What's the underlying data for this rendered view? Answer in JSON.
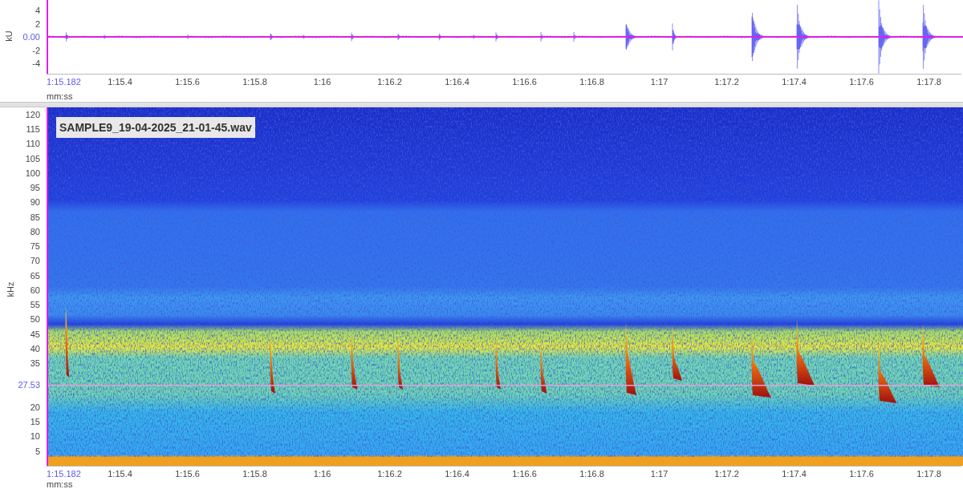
{
  "waveform_panel": {
    "y_axis_label": "kU",
    "y_ticks": [
      {
        "label": "4",
        "highlighted": false
      },
      {
        "label": "2",
        "highlighted": false
      },
      {
        "label": "0.00",
        "highlighted": true
      },
      {
        "label": "-2",
        "highlighted": false
      },
      {
        "label": "-4",
        "highlighted": false
      }
    ],
    "time_axis": {
      "ticks": [
        {
          "label": "1:15.182",
          "highlighted": true
        },
        {
          "label": "1:15.4",
          "highlighted": false
        },
        {
          "label": "1:15.6",
          "highlighted": false
        },
        {
          "label": "1:15.8",
          "highlighted": false
        },
        {
          "label": "1:16",
          "highlighted": false
        },
        {
          "label": "1:16.2",
          "highlighted": false
        },
        {
          "label": "1:16.4",
          "highlighted": false
        },
        {
          "label": "1:16.6",
          "highlighted": false
        },
        {
          "label": "1:16.8",
          "highlighted": false
        },
        {
          "label": "1:17",
          "highlighted": false
        },
        {
          "label": "1:17.2",
          "highlighted": false
        },
        {
          "label": "1:17.4",
          "highlighted": false
        },
        {
          "label": "1:17.6",
          "highlighted": false
        },
        {
          "label": "1:17.8",
          "highlighted": false
        }
      ],
      "unit": "mm:ss"
    }
  },
  "spectrogram_panel": {
    "file_label": "SAMPLE9_19-04-2025_21-01-45.wav",
    "y_axis_label": "kHz",
    "y_ticks": [
      {
        "label": "120",
        "highlighted": false
      },
      {
        "label": "115",
        "highlighted": false
      },
      {
        "label": "110",
        "highlighted": false
      },
      {
        "label": "105",
        "highlighted": false
      },
      {
        "label": "100",
        "highlighted": false
      },
      {
        "label": "95",
        "highlighted": false
      },
      {
        "label": "90",
        "highlighted": false
      },
      {
        "label": "85",
        "highlighted": false
      },
      {
        "label": "80",
        "highlighted": false
      },
      {
        "label": "75",
        "highlighted": false
      },
      {
        "label": "70",
        "highlighted": false
      },
      {
        "label": "65",
        "highlighted": false
      },
      {
        "label": "60",
        "highlighted": false
      },
      {
        "label": "55",
        "highlighted": false
      },
      {
        "label": "50",
        "highlighted": false
      },
      {
        "label": "45",
        "highlighted": false
      },
      {
        "label": "40",
        "highlighted": false
      },
      {
        "label": "35",
        "highlighted": false
      },
      {
        "label": "27.53",
        "highlighted": true
      },
      {
        "label": "20",
        "highlighted": false
      },
      {
        "label": "15",
        "highlighted": false
      },
      {
        "label": "10",
        "highlighted": false
      },
      {
        "label": "5",
        "highlighted": false
      }
    ],
    "time_axis": {
      "ticks": [
        {
          "label": "1:15.182",
          "highlighted": true
        },
        {
          "label": "1:15.4",
          "highlighted": false
        },
        {
          "label": "1:15.6",
          "highlighted": false
        },
        {
          "label": "1:15.8",
          "highlighted": false
        },
        {
          "label": "1:16",
          "highlighted": false
        },
        {
          "label": "1:16.2",
          "highlighted": false
        },
        {
          "label": "1:16.4",
          "highlighted": false
        },
        {
          "label": "1:16.6",
          "highlighted": false
        },
        {
          "label": "1:16.8",
          "highlighted": false
        },
        {
          "label": "1:17",
          "highlighted": false
        },
        {
          "label": "1:17.2",
          "highlighted": false
        },
        {
          "label": "1:17.4",
          "highlighted": false
        },
        {
          "label": "1:17.6",
          "highlighted": false
        },
        {
          "label": "1:17.8",
          "highlighted": false
        }
      ],
      "unit": "mm:ss"
    }
  }
}
